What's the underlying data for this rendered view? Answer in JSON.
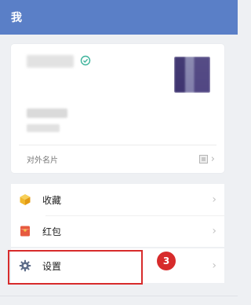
{
  "header": {
    "title": "我"
  },
  "profile": {
    "card_footer_label": "对外名片"
  },
  "menu": {
    "items": [
      {
        "label": "收藏",
        "icon": "cube-icon",
        "color": "#f1b82d"
      },
      {
        "label": "红包",
        "icon": "red-envelope-icon",
        "color": "#e65a3f"
      }
    ]
  },
  "settings": {
    "label": "设置",
    "icon": "gear-icon"
  },
  "annotation": {
    "step_number": "3",
    "color": "#d72b2b"
  },
  "colors": {
    "header": "#5a7fc7",
    "verified": "#3db39b"
  }
}
